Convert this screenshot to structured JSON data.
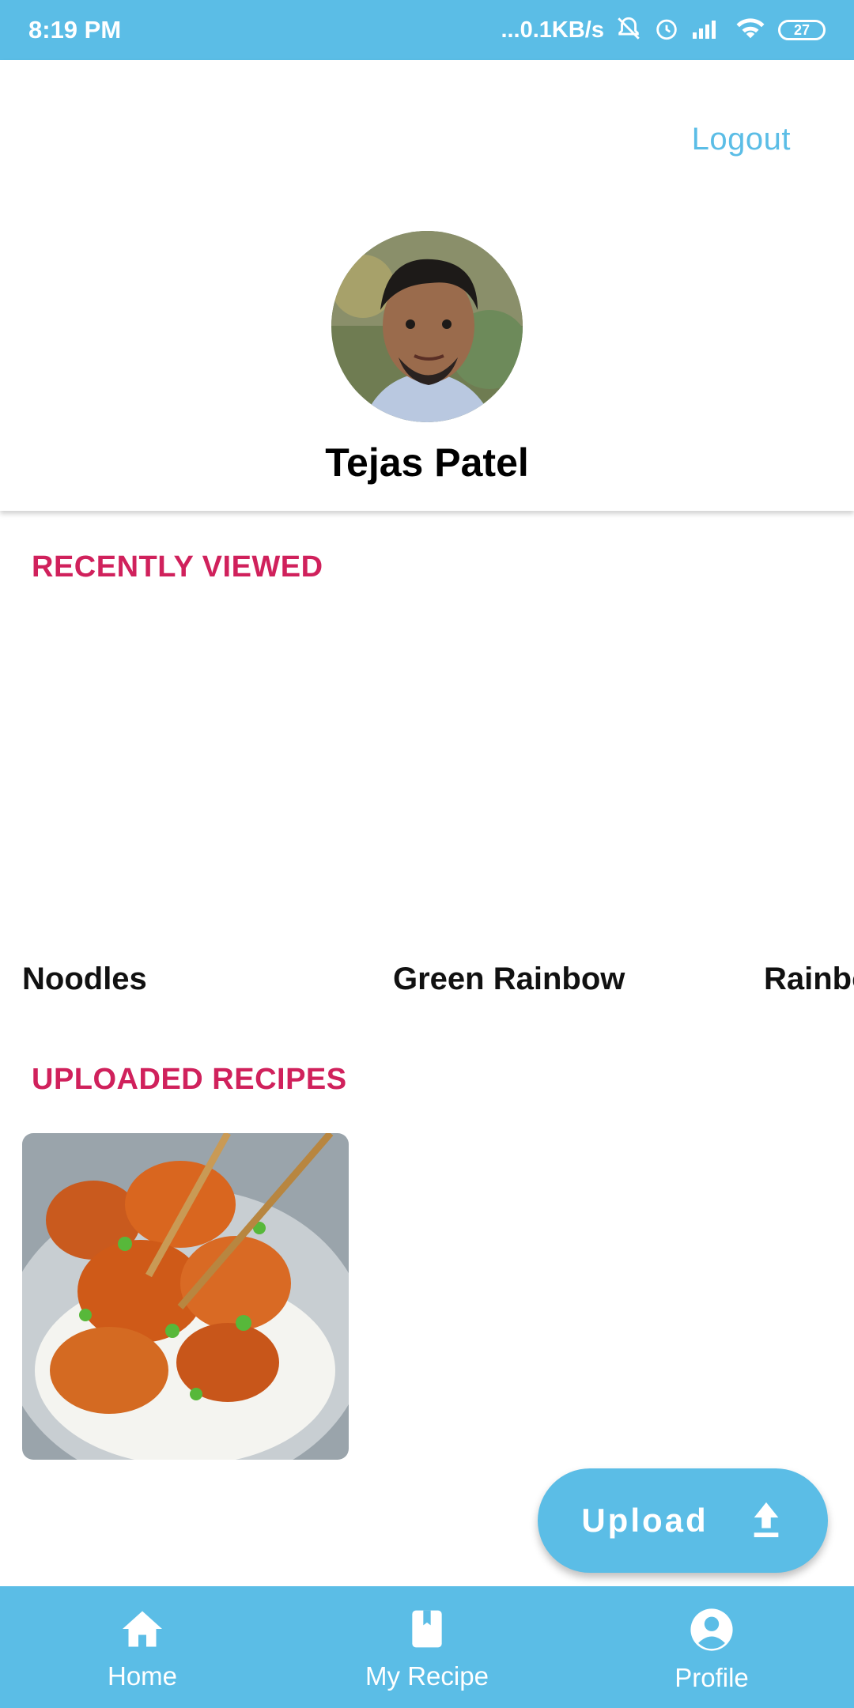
{
  "status_bar": {
    "time": "8:19 PM",
    "net_speed": "...0.1KB/s",
    "battery": "27"
  },
  "header": {
    "logout_label": "Logout",
    "user_name": "Tejas Patel"
  },
  "recently_viewed": {
    "title": "RECENTLY VIEWED",
    "items": [
      "Noodles",
      "Green Rainbow",
      "Rainbo"
    ]
  },
  "uploaded_recipes": {
    "title": "UPLOADED RECIPES"
  },
  "fab": {
    "label": "Upload",
    "icon": "upload-icon"
  },
  "bottom_nav": {
    "items": [
      {
        "label": "Home",
        "icon": "home-icon"
      },
      {
        "label": "My Recipe",
        "icon": "book-icon"
      },
      {
        "label": "Profile",
        "icon": "account-circle-icon"
      }
    ]
  },
  "colors": {
    "primary": "#5bbde6",
    "accent": "#d0215c"
  }
}
